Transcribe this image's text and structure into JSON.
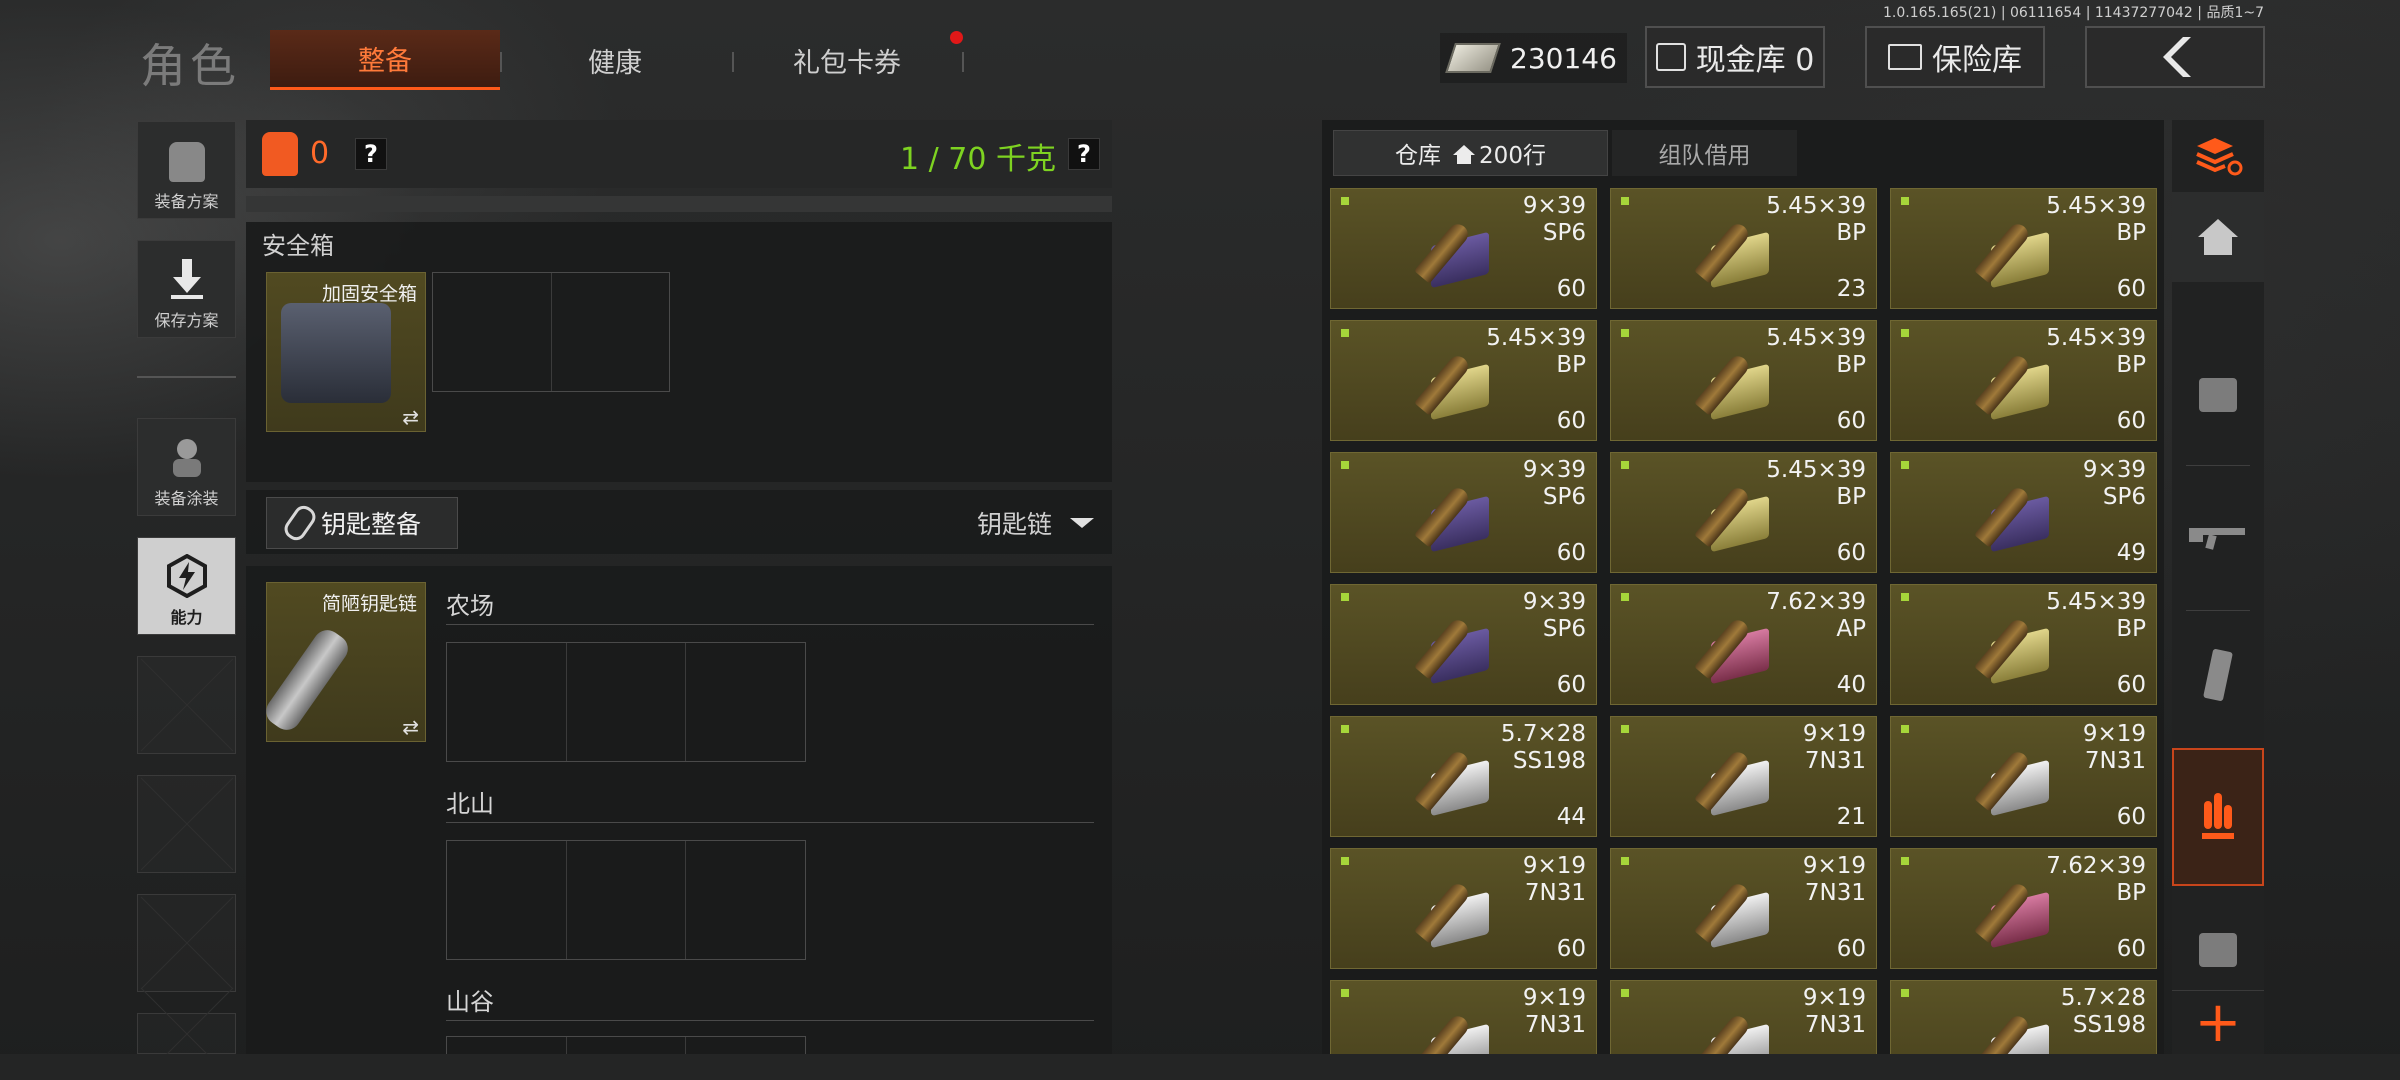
{
  "version": "1.0.165.165(21) | 06111654 | 11437277042 | 品质1~7",
  "header": {
    "title": "角色",
    "tabs": [
      "整备",
      "健康",
      "礼包卡券"
    ],
    "money": "230146",
    "cash_vault": "现金库 0",
    "insurance": "保险库",
    "colors": {
      "accent": "#ff5a1a",
      "weight_green": "#7ed321"
    }
  },
  "left_menu": {
    "items": [
      "装备方案",
      "保存方案",
      "装备涂装",
      "能力"
    ]
  },
  "gear": {
    "vest_count": "0",
    "weight": "1 / 70 千克",
    "help": "?"
  },
  "safe_box": {
    "section": "安全箱",
    "item_name": "加固安全箱",
    "swap": "⇄"
  },
  "keys": {
    "button": "钥匙整备",
    "dropdown": "钥匙链",
    "item_name": "简陋钥匙链",
    "swap": "⇄",
    "locations": [
      "农场",
      "北山",
      "山谷"
    ]
  },
  "warehouse": {
    "tabs": [
      "仓库",
      "200行",
      "组队借用"
    ],
    "items": [
      {
        "cal": "9×39",
        "type": "SP6",
        "count": "60",
        "box": "purple"
      },
      {
        "cal": "5.45×39",
        "type": "BP",
        "count": "23",
        "box": "yellow"
      },
      {
        "cal": "5.45×39",
        "type": "BP",
        "count": "60",
        "box": "yellow"
      },
      {
        "cal": "5.45×39",
        "type": "BP",
        "count": "60",
        "box": "yellow"
      },
      {
        "cal": "5.45×39",
        "type": "BP",
        "count": "60",
        "box": "yellow"
      },
      {
        "cal": "5.45×39",
        "type": "BP",
        "count": "60",
        "box": "yellow"
      },
      {
        "cal": "9×39",
        "type": "SP6",
        "count": "60",
        "box": "purple"
      },
      {
        "cal": "5.45×39",
        "type": "BP",
        "count": "60",
        "box": "yellow"
      },
      {
        "cal": "9×39",
        "type": "SP6",
        "count": "49",
        "box": "purple"
      },
      {
        "cal": "9×39",
        "type": "SP6",
        "count": "60",
        "box": "purple"
      },
      {
        "cal": "7.62×39",
        "type": "AP",
        "count": "40",
        "box": "pink"
      },
      {
        "cal": "5.45×39",
        "type": "BP",
        "count": "60",
        "box": "yellow"
      },
      {
        "cal": "5.7×28",
        "type": "SS198",
        "count": "44",
        "box": "white"
      },
      {
        "cal": "9×19",
        "type": "7N31",
        "count": "21",
        "box": "white"
      },
      {
        "cal": "9×19",
        "type": "7N31",
        "count": "60",
        "box": "white"
      },
      {
        "cal": "9×19",
        "type": "7N31",
        "count": "60",
        "box": "white"
      },
      {
        "cal": "9×19",
        "type": "7N31",
        "count": "60",
        "box": "white"
      },
      {
        "cal": "7.62×39",
        "type": "BP",
        "count": "60",
        "box": "pink"
      },
      {
        "cal": "9×19",
        "type": "7N31",
        "count": "",
        "box": "white"
      },
      {
        "cal": "9×19",
        "type": "7N31",
        "count": "",
        "box": "white"
      },
      {
        "cal": "5.7×28",
        "type": "SS198",
        "count": "",
        "box": "white"
      }
    ]
  },
  "side_panel": {
    "add": "+"
  }
}
